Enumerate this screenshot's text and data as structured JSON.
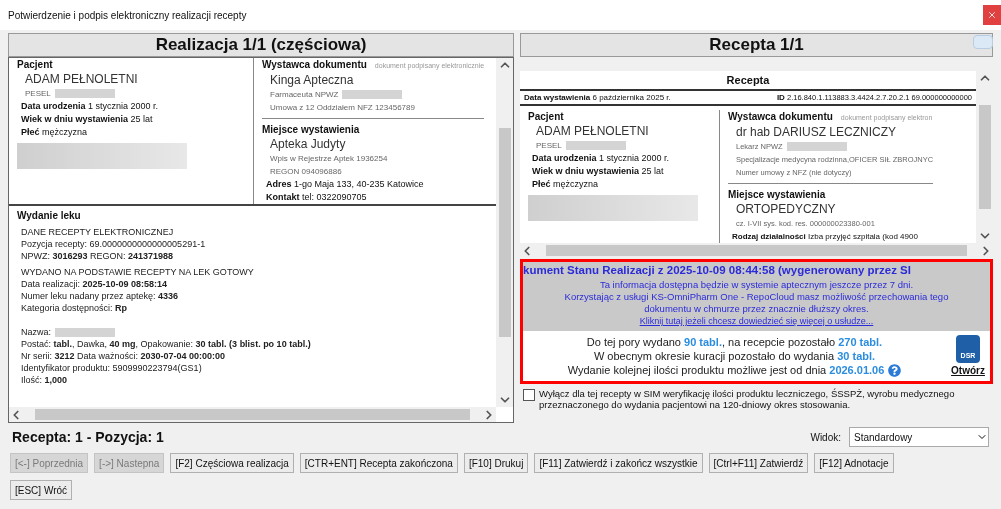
{
  "window": {
    "title": "Potwierdzenie i podpis elektroniczny realizacji recepty"
  },
  "realization": {
    "header": "Realizacja 1/1 (częściowa)",
    "patient": {
      "heading": "Pacjent",
      "name": "ADAM PEŁNOLETNI",
      "lines": [
        {
          "text": "PESEL",
          "redacted": true
        }
      ],
      "details": [
        "**Data urodzenia** 1 stycznia 2000 r.",
        "**Wiek w dniu wystawienia** 25 lat",
        "**Płeć** mężczyzna"
      ],
      "redacted_block": true
    },
    "issuer": {
      "heading": "Wystawca dokumentu",
      "note": "dokument podpisany elektronicznie",
      "name": "Kinga Apteczna",
      "lines": [
        {
          "text": "Farmaceuta NPWZ",
          "redacted": true
        },
        {
          "text": "Umowa z 12 Oddziałem NFZ 123456789",
          "redacted": false
        }
      ]
    },
    "place": {
      "heading": "Miejsce wystawienia",
      "name": "Apteka Judyty",
      "lines": [
        {
          "text": "Wpis w Rejestrze Aptek 1936254",
          "redacted": false
        },
        {
          "text": "REGON 094096886",
          "redacted": false
        }
      ],
      "details": [
        "**Adres** 1-go Maja 133, 40-235 Katowice",
        "**Kontakt** tel: 0322090705"
      ]
    },
    "dispense": {
      "heading": "Wydanie leku",
      "groups": [
        [
          {
            "text": "DANE RECEPTY ELEKTRONICZNEJ",
            "redacted": false
          },
          {
            "text": "Pozycja recepty: 69.0000000000000005291-1",
            "redacted": false
          },
          {
            "text": "NPWZ: **3016293** REGON: **241371988**",
            "redacted": false
          }
        ],
        [
          {
            "text": "WYDANO NA PODSTAWIE RECEPTY NA LEK GOTOWY",
            "redacted": false
          },
          {
            "text": "Data realizacji: **2025-10-09 08:58:14**",
            "redacted": false
          },
          {
            "text": "Numer leku nadany przez aptekę: **4336**",
            "redacted": false
          },
          {
            "text": "Kategoria dostępności: **Rp**",
            "redacted": false
          }
        ],
        [
          {
            "text": "Nazwa:",
            "redacted": true
          },
          {
            "text": "Postać: **tabl.**, Dawka, **40 mg**, Opakowanie: **30 tabl. (3 blist. po 10 tabl.)**",
            "redacted": false
          },
          {
            "text": "Nr serii: **3212** Data ważności: **2030-07-04 00:00:00**",
            "redacted": false
          },
          {
            "text": "Identyfikator produktu: 5909990223794(GS1)",
            "redacted": false
          },
          {
            "text": "Ilość: **1,000**",
            "redacted": false
          }
        ]
      ]
    }
  },
  "prescription": {
    "header": "Recepta 1/1",
    "doc_title": "Recepta",
    "issued": "**Data wystawienia** 6 października 2025 r.",
    "id": "**ID** 2.16.840.1.113883.3.4424.2.7.20.2.1 69.000000000000",
    "patient": {
      "heading": "Pacjent",
      "name": "ADAM PEŁNOLETNI",
      "lines": [
        {
          "text": "PESEL",
          "redacted": true
        }
      ],
      "details": [
        "**Data urodzenia** 1 stycznia 2000 r.",
        "**Wiek w dniu wystawienia** 25 lat",
        "**Płeć** mężczyzna"
      ],
      "redacted_block": true
    },
    "issuer": {
      "heading": "Wystawca dokumentu",
      "note": "dokument podpisany elektron",
      "name": "dr hab DARIUSZ LECZNICZY",
      "lines": [
        {
          "text": "Lekarz NPWZ",
          "redacted": true
        },
        {
          "text": "Specjalizacje medycyna rodzinna,OFICER SIŁ ZBROJNYC",
          "redacted": false
        },
        {
          "text": "Numer umowy z NFZ (nie dotyczy)",
          "redacted": false
        }
      ]
    },
    "place": {
      "heading": "Miejsce wystawienia",
      "name": "ORTOPEDYCZNY",
      "lines": [
        {
          "text": "cz. I-VII sys. kod. res. 000000023380-001",
          "redacted": false
        }
      ],
      "details": [
        "**Rodzaj działalności** Izba przyjęć szpitala (kod 4900"
      ]
    }
  },
  "status_document": {
    "heading": "kument Stanu Realizacji z 2025-10-09 08:44:58 (wygenerowany przez SI",
    "info": [
      "Ta informacja dostępna będzie w systemie aptecznym jeszcze przez 7 dni.",
      "Korzystając z usługi KS-OmniPharm One - RepoCloud masz możliwość przechowania tego dokumentu w chmurze przez znacznie dłuższy okres."
    ],
    "link": "Kliknij tutaj jeżeli chcesz dowiedzieć się więcej o usłudze...",
    "summary": [
      "Do tej pory wydano **90 tabl.**, na recepcie pozostało **270 tabl.**",
      "W obecnym okresie kuracji pozostało do wydania **30 tabl.**",
      "Wydanie kolejnej ilości produktu możliwe jest od dnia **2026.01.06**"
    ],
    "dsr_label": "DSR",
    "open_label": "Otwórz"
  },
  "sim_checkbox": {
    "label": "Wyłącz dla tej recepty w SIM weryfikację ilości produktu leczniczego, ŚSSPŻ, wyrobu medycznego przeznaczonego do wydania pacjentowi na 120-dniowy okres stosowania.",
    "checked": false
  },
  "status": "Recepta: 1 - Pozycja: 1",
  "view": {
    "label": "Widok:",
    "value": "Standardowy"
  },
  "buttons": [
    {
      "label": "[<-] Poprzednia",
      "disabled": true
    },
    {
      "label": "[->] Nastepna",
      "disabled": true
    },
    {
      "label": "[F2] Częściowa realizacja",
      "disabled": false
    },
    {
      "label": "[CTR+ENT] Recepta zakończona",
      "disabled": false
    },
    {
      "label": "[F10] Drukuj",
      "disabled": false
    },
    {
      "label": "[F11] Zatwierdź i zakończ wszystkie",
      "disabled": false
    },
    {
      "label": "[Ctrl+F11] Zatwierdź",
      "disabled": false
    },
    {
      "label": "[F12] Adnotacje",
      "disabled": false
    },
    {
      "label": "[ESC] Wróć",
      "disabled": false
    }
  ]
}
